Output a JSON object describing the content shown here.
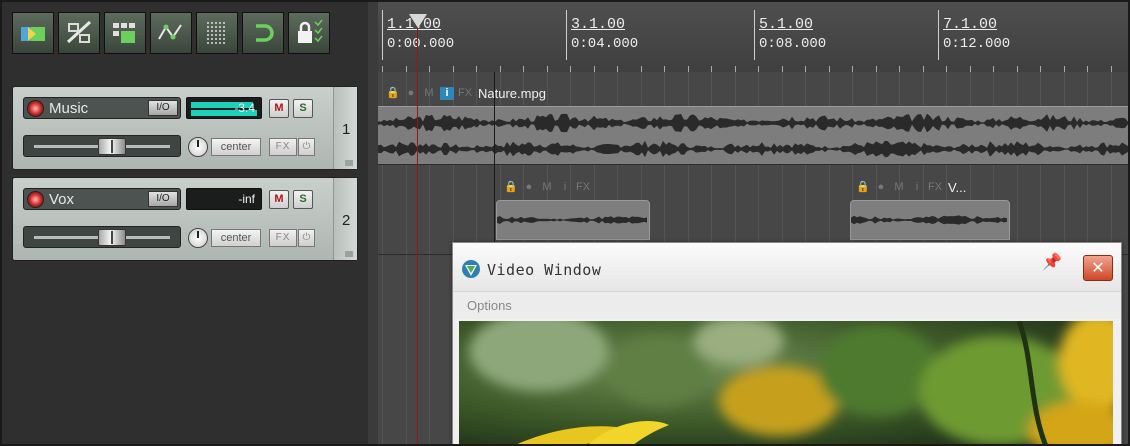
{
  "toolbar": {
    "buttons": [
      {
        "name": "auto-crossfade",
        "icon": "crossfade-icon"
      },
      {
        "name": "ripple-edit",
        "icon": "ripple-icon"
      },
      {
        "name": "item-grouping",
        "icon": "grouping-icon"
      },
      {
        "name": "envelope-points",
        "icon": "envelope-icon"
      },
      {
        "name": "snap-grid",
        "icon": "grid-icon"
      },
      {
        "name": "loop-repeat",
        "icon": "loop-icon"
      },
      {
        "name": "locking",
        "icon": "lock-icon"
      }
    ],
    "accent": "#5ec853"
  },
  "ruler": {
    "marks": [
      {
        "bar": "1.1.00",
        "time": "0:00.000"
      },
      {
        "bar": "3.1.00",
        "time": "0:04.000"
      },
      {
        "bar": "5.1.00",
        "time": "0:08.000"
      },
      {
        "bar": "7.1.00",
        "time": "0:12.000"
      }
    ]
  },
  "tracks": [
    {
      "number": "1",
      "name": "Music",
      "io_label": "I/O",
      "meter_value": "-3.4",
      "mute_label": "M",
      "solo_label": "S",
      "pan_label": "center",
      "fx_label": "FX",
      "phase_label": "⏻"
    },
    {
      "number": "2",
      "name": "Vox",
      "io_label": "I/O",
      "meter_value": "-inf",
      "mute_label": "M",
      "solo_label": "S",
      "pan_label": "center",
      "fx_label": "FX",
      "phase_label": "⏻"
    }
  ],
  "items": {
    "nature": {
      "name": "Nature.mpg",
      "icons": [
        "lock-icon",
        "note-icon",
        "M",
        "i",
        "FX"
      ]
    },
    "vox_a": {
      "name": "",
      "icons": [
        "lock-icon",
        "note-icon",
        "M",
        "i",
        "FX"
      ]
    },
    "vox_b": {
      "name": "V...",
      "icons": [
        "lock-icon",
        "note-icon",
        "M",
        "i",
        "FX"
      ]
    },
    "label_m": "M",
    "label_i": "i",
    "label_fx": "FX"
  },
  "video_window": {
    "title": "Video Window",
    "menu": [
      "Options"
    ],
    "close_label": "✕",
    "pin_label": "☲"
  },
  "colors": {
    "play_cursor": "#8c1b1b",
    "meter": "#1fd0b8",
    "close_button": "#cf4627"
  }
}
